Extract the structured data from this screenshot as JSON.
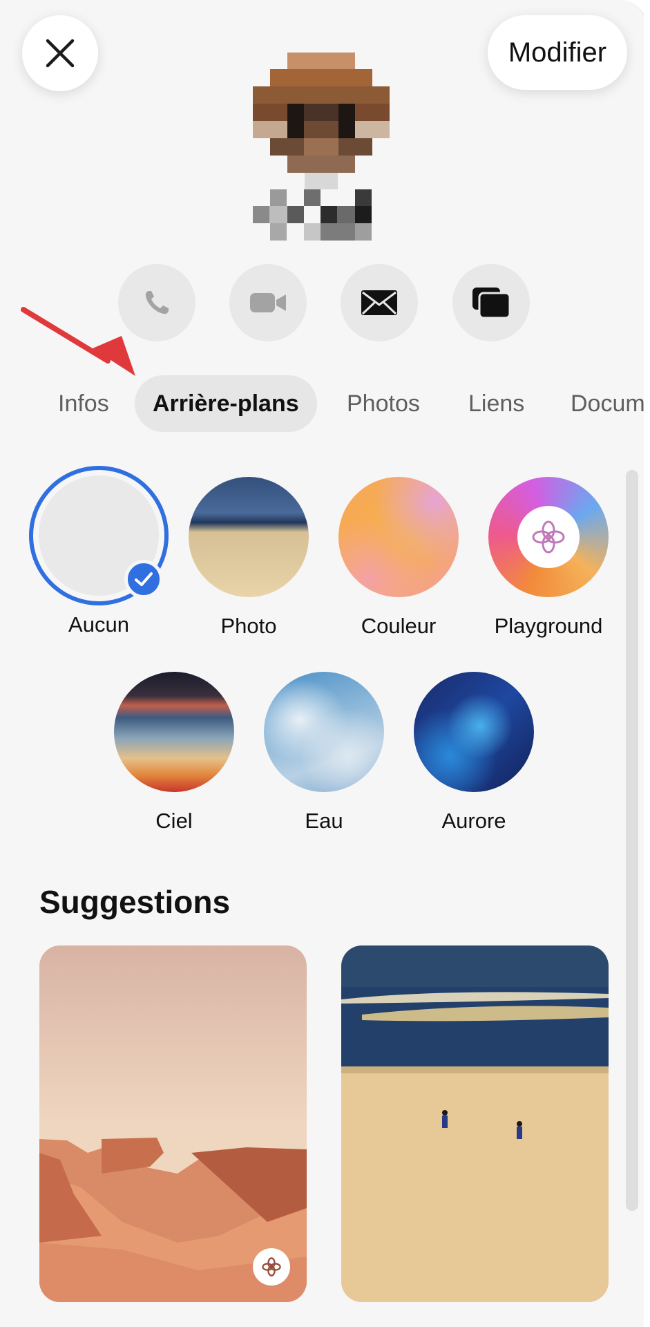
{
  "header": {
    "edit_label": "Modifier"
  },
  "tabs": [
    "Infos",
    "Arrière-plans",
    "Photos",
    "Liens",
    "Docum"
  ],
  "backgrounds": [
    {
      "label": "Aucun",
      "selected": true
    },
    {
      "label": "Photo"
    },
    {
      "label": "Couleur"
    },
    {
      "label": "Playground"
    },
    {
      "label": "Ciel"
    },
    {
      "label": "Eau"
    },
    {
      "label": "Aurore"
    }
  ],
  "suggestions": {
    "title": "Suggestions"
  },
  "colors": {
    "accent": "#2f6fe0",
    "annotation_arrow": "#e0393b"
  }
}
